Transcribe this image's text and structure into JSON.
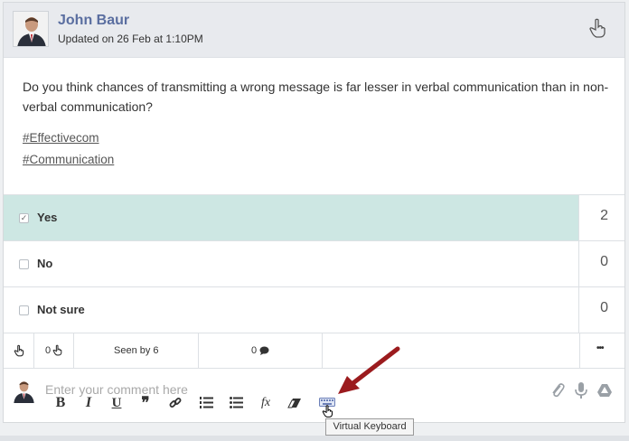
{
  "post": {
    "author": "John Baur",
    "updated": "Updated on 26 Feb at 1:10PM",
    "question": "Do you think chances of transmitting a wrong message is far lesser in verbal communication than in non-verbal communication?",
    "tags": [
      "#Effectivecom",
      "#Communication"
    ]
  },
  "poll": {
    "options": [
      {
        "label": "Yes",
        "count": "2",
        "selected": true
      },
      {
        "label": "No",
        "count": "0",
        "selected": false
      },
      {
        "label": "Not sure",
        "count": "0",
        "selected": false
      }
    ]
  },
  "actions": {
    "like_count": "0",
    "seen_by": "Seen by 6",
    "comment_count": "0",
    "more": "•••"
  },
  "comment": {
    "placeholder": "Enter your comment here",
    "toolbar": {
      "bold": "B",
      "italic": "I",
      "underline": "U",
      "quote": "❞",
      "formula": "fx"
    }
  },
  "tooltip": "Virtual Keyboard",
  "colors": {
    "author": "#5a6ea0",
    "selected_row": "#cde7e3",
    "arrow": "#9b1b1e"
  }
}
